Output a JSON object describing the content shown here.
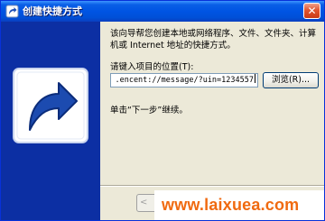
{
  "window": {
    "title": "创建快捷方式",
    "close_glyph": "✕"
  },
  "icons": {
    "title": "shortcut-icon",
    "side_art": "shortcut-arrow-icon",
    "close": "close-icon"
  },
  "content": {
    "intro": "该向导帮您创建本地或网络程序、文件、文件夹、计算机或 Internet 地址的快捷方式。",
    "location_label": "请键入项目的位置(T):",
    "location_value": ".encent://message/?uin=1234557",
    "browse_label": "浏览(R)...",
    "next_hint": "单击“下一步”继续。"
  },
  "footer": {
    "back_glyph": "<"
  },
  "watermark": {
    "text": "www.laixuea.com"
  },
  "colors": {
    "titlebar": "#0054e3",
    "side_panel": "#0c2fa3",
    "dialog_bg": "#ece9d8",
    "watermark": "#f06a10"
  }
}
